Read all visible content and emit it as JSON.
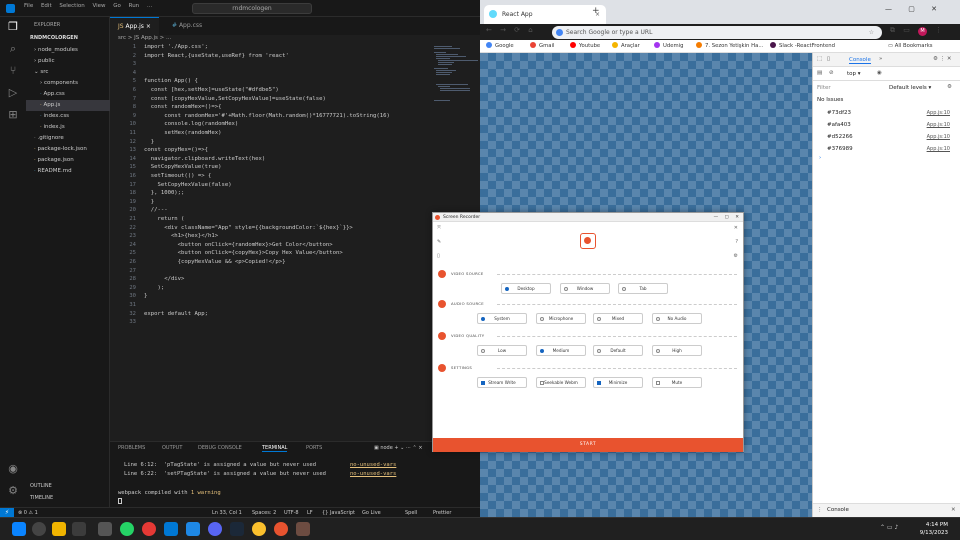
{
  "vscode": {
    "search": "rndmcologen",
    "explorer_title": "EXPLORER",
    "project": "RNDMCOLORGEN",
    "tree": [
      "node_modules",
      "public",
      "src",
      "components",
      "App.css",
      "App.js",
      "index.css",
      "index.js",
      ".gitignore",
      "package-lock.json",
      "package.json",
      "README.md"
    ],
    "outline": "OUTLINE",
    "timeline": "TIMELINE",
    "tabs": [
      "App.js",
      "App.css"
    ],
    "breadcrumb": "src > JS App.js > ...",
    "code": [
      "import './App.css';",
      "import React,{useState,useRef} from 'react'",
      "",
      "",
      "function App() {",
      "  const [hex,setHex]=useState(\"#dfdbe5\")",
      "  const [copyHexValue,SetCopyHexValue]=useState(false)",
      "  const randomHex=()=>{",
      "      const randomHex='#'+Math.floor(Math.random()*16777721).toString(16)",
      "      console.log(randomHex)",
      "      setHex(randomHex)",
      "  }",
      "const copyHex=()=>{",
      "  navigator.clipboard.writeText(hex)",
      "  SetCopyHexValue(true)",
      "  setTimeout(() => {",
      "    SetCopyHexValue(false)",
      "  }, 1000);;",
      "  }",
      "  //---",
      "    return (",
      "      <div className=\"App\" style={{backgroundColor:`${hex}`}}>",
      "        <h1>{hex}</h1>",
      "          <button onClick={randomHex}>Get Color</button>",
      "          <button onClick={copyHex}>Copy Hex Value</button>",
      "          {copyHexValue && <p>Copied!</p>}",
      "",
      "      </div>",
      "    );",
      "}",
      "",
      "export default App;",
      ""
    ],
    "panel_tabs": [
      "PROBLEMS",
      "OUTPUT",
      "DEBUG CONSOLE",
      "TERMINAL",
      "PORTS"
    ],
    "terminal_label": "node",
    "terminal": [
      {
        "text": "Line 6:12:  'pTagState' is assigned a value but never used",
        "rule": "no-unused-vars"
      },
      {
        "text": "Line 6:22:  'setPTagState' is assigned a value but never used",
        "rule": "no-unused-vars"
      }
    ],
    "compiled_pre": "webpack compiled with ",
    "compiled_warn": "1 warning",
    "status": [
      "Ln 33, Col 1",
      "Spaces: 2",
      "UTF-8",
      "LF",
      "{} JavaScript",
      "Go Live",
      "Spell",
      "Prettier"
    ]
  },
  "chrome": {
    "tab_title": "React App",
    "address": "Search Google or type a URL",
    "bookmarks": [
      "Google",
      "Gmail",
      "Youtube",
      "Araçlar",
      "Udemig",
      "7. Sezon Yetişkin Ha...",
      "Slack -ReactFrontend"
    ],
    "all_bookmarks": "All Bookmarks",
    "devtools": {
      "tab": "Console",
      "context": "top",
      "filter_placeholder": "Filter",
      "levels": "Default levels",
      "issues": "No Issues",
      "logs": [
        {
          "value": "#73df23",
          "src": "App.js:10"
        },
        {
          "value": "#afa403",
          "src": "App.js:10"
        },
        {
          "value": "#d52266",
          "src": "App.js:10"
        },
        {
          "value": "#376989",
          "src": "App.js:10"
        }
      ],
      "drawer_tab": "Console"
    }
  },
  "recorder": {
    "title": "Screen Recorder",
    "sections": [
      {
        "label": "VIDEO SOURCE",
        "options": [
          {
            "text": "Desktop",
            "on": true
          },
          {
            "text": "Window",
            "on": false
          },
          {
            "text": "Tab",
            "on": false
          }
        ]
      },
      {
        "label": "AUDIO SOURCE",
        "options": [
          {
            "text": "System",
            "on": true
          },
          {
            "text": "Microphone",
            "on": false
          },
          {
            "text": "Mixed",
            "on": false
          },
          {
            "text": "No Audio",
            "on": false
          }
        ]
      },
      {
        "label": "VIDEO QUALITY",
        "options": [
          {
            "text": "Low",
            "on": false
          },
          {
            "text": "Medium",
            "on": true
          },
          {
            "text": "Default",
            "on": false
          },
          {
            "text": "High",
            "on": false
          }
        ]
      },
      {
        "label": "SETTINGS",
        "options": [
          {
            "text": "Stream Write",
            "on": true
          },
          {
            "text": "Seekable Webm",
            "on": false
          },
          {
            "text": "Minimize",
            "on": true
          },
          {
            "text": "Mute",
            "on": false
          }
        ]
      }
    ],
    "start": "START"
  },
  "taskbar": {
    "time": "4:14 PM",
    "date": "9/13/2023"
  }
}
